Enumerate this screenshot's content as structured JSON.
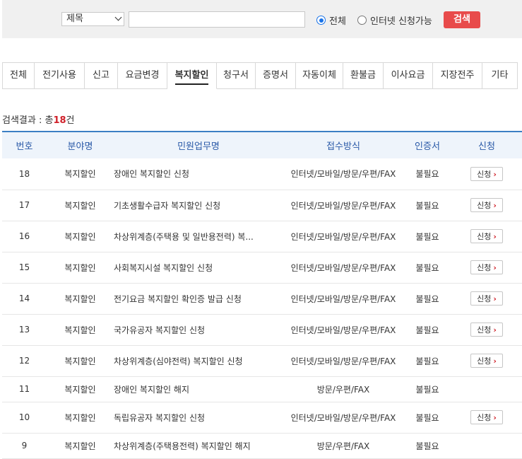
{
  "search": {
    "select_value": "제목",
    "input_value": "",
    "radio_all": "전체",
    "radio_online": "인터넷 신청가능",
    "button": "검색"
  },
  "tabs": [
    {
      "label": "전체",
      "active": false
    },
    {
      "label": "전기사용",
      "active": false
    },
    {
      "label": "신고",
      "active": false
    },
    {
      "label": "요금변경",
      "active": false
    },
    {
      "label": "복지할인",
      "active": true
    },
    {
      "label": "청구서",
      "active": false
    },
    {
      "label": "증명서",
      "active": false
    },
    {
      "label": "자동이체",
      "active": false
    },
    {
      "label": "환불금",
      "active": false
    },
    {
      "label": "이사요금",
      "active": false
    },
    {
      "label": "지장전주",
      "active": false
    },
    {
      "label": "기타",
      "active": false
    }
  ],
  "result": {
    "prefix": "검색결과 : 총",
    "count": "18",
    "suffix": "건"
  },
  "table": {
    "headers": [
      "번호",
      "분야명",
      "민원업무명",
      "접수방식",
      "인증서",
      "신청"
    ],
    "apply_label": "신청",
    "rows": [
      {
        "no": "18",
        "field": "복지할인",
        "task": "장애인 복지할인 신청",
        "method": "인터넷/모바일/방문/우편/FAX",
        "cert": "불필요",
        "apply": true
      },
      {
        "no": "17",
        "field": "복지할인",
        "task": "기초생활수급자 복지할인 신청",
        "method": "인터넷/모바일/방문/우편/FAX",
        "cert": "불필요",
        "apply": true
      },
      {
        "no": "16",
        "field": "복지할인",
        "task": "차상위계층(주택용 및 일반용전력) 복...",
        "method": "인터넷/모바일/방문/우편/FAX",
        "cert": "불필요",
        "apply": true
      },
      {
        "no": "15",
        "field": "복지할인",
        "task": "사회복지시설 복지할인 신청",
        "method": "인터넷/모바일/방문/우편/FAX",
        "cert": "불필요",
        "apply": true
      },
      {
        "no": "14",
        "field": "복지할인",
        "task": "전기요금 복지할인 확인증 발급 신청",
        "method": "인터넷/모바일/방문/우편/FAX",
        "cert": "불필요",
        "apply": true
      },
      {
        "no": "13",
        "field": "복지할인",
        "task": "국가유공자 복지할인 신청",
        "method": "인터넷/모바일/방문/우편/FAX",
        "cert": "불필요",
        "apply": true
      },
      {
        "no": "12",
        "field": "복지할인",
        "task": "차상위계층(심야전력) 복지할인 신청",
        "method": "인터넷/모바일/방문/우편/FAX",
        "cert": "불필요",
        "apply": true
      },
      {
        "no": "11",
        "field": "복지할인",
        "task": "장애인 복지할인 해지",
        "method": "방문/우편/FAX",
        "cert": "불필요",
        "apply": false
      },
      {
        "no": "10",
        "field": "복지할인",
        "task": "독립유공자 복지할인 신청",
        "method": "인터넷/모바일/방문/우편/FAX",
        "cert": "불필요",
        "apply": true
      },
      {
        "no": "9",
        "field": "복지할인",
        "task": "차상위계층(주택용전력) 복지할인 해지",
        "method": "방문/우편/FAX",
        "cert": "불필요",
        "apply": false
      }
    ]
  }
}
